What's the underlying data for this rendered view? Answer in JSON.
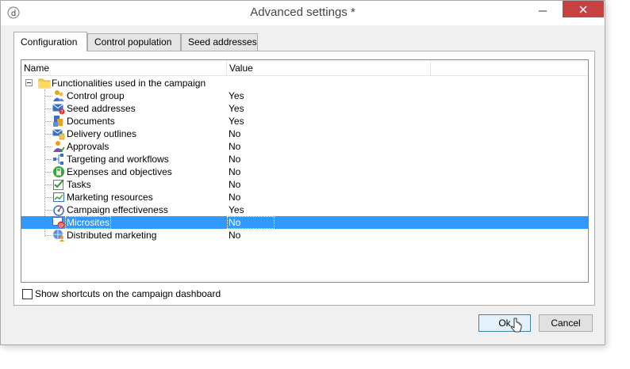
{
  "window": {
    "title": "Advanced settings *"
  },
  "tabs": [
    {
      "label": "Configuration",
      "active": true
    },
    {
      "label": "Control population",
      "active": false
    },
    {
      "label": "Seed addresses",
      "active": false
    }
  ],
  "tree": {
    "columns": [
      "Name",
      "Value"
    ],
    "group": "Functionalities used in the campaign",
    "rows": [
      {
        "label": "Control group",
        "value": "Yes",
        "icon": "people-icon"
      },
      {
        "label": "Seed addresses",
        "value": "Yes",
        "icon": "envelope-question-icon"
      },
      {
        "label": "Documents",
        "value": "Yes",
        "icon": "documents-icon"
      },
      {
        "label": "Delivery outlines",
        "value": "No",
        "icon": "envelope-list-icon"
      },
      {
        "label": "Approvals",
        "value": "No",
        "icon": "approval-user-icon"
      },
      {
        "label": "Targeting and workflows",
        "value": "No",
        "icon": "workflow-icon"
      },
      {
        "label": "Expenses and objectives",
        "value": "No",
        "icon": "calculator-icon"
      },
      {
        "label": "Tasks",
        "value": "No",
        "icon": "task-check-icon"
      },
      {
        "label": "Marketing resources",
        "value": "No",
        "icon": "chart-resource-icon"
      },
      {
        "label": "Campaign effectiveness",
        "value": "Yes",
        "icon": "effectiveness-icon"
      },
      {
        "label": "Microsites",
        "value": "No",
        "icon": "microsite-icon",
        "selected": true
      },
      {
        "label": "Distributed marketing",
        "value": "No",
        "icon": "globe-user-icon"
      }
    ]
  },
  "shortcut_checkbox": {
    "label": "Show shortcuts on the campaign dashboard",
    "checked": false
  },
  "buttons": {
    "ok": "Ok",
    "cancel": "Cancel"
  },
  "colors": {
    "selection": "#3399ff",
    "close_button": "#c74141"
  }
}
